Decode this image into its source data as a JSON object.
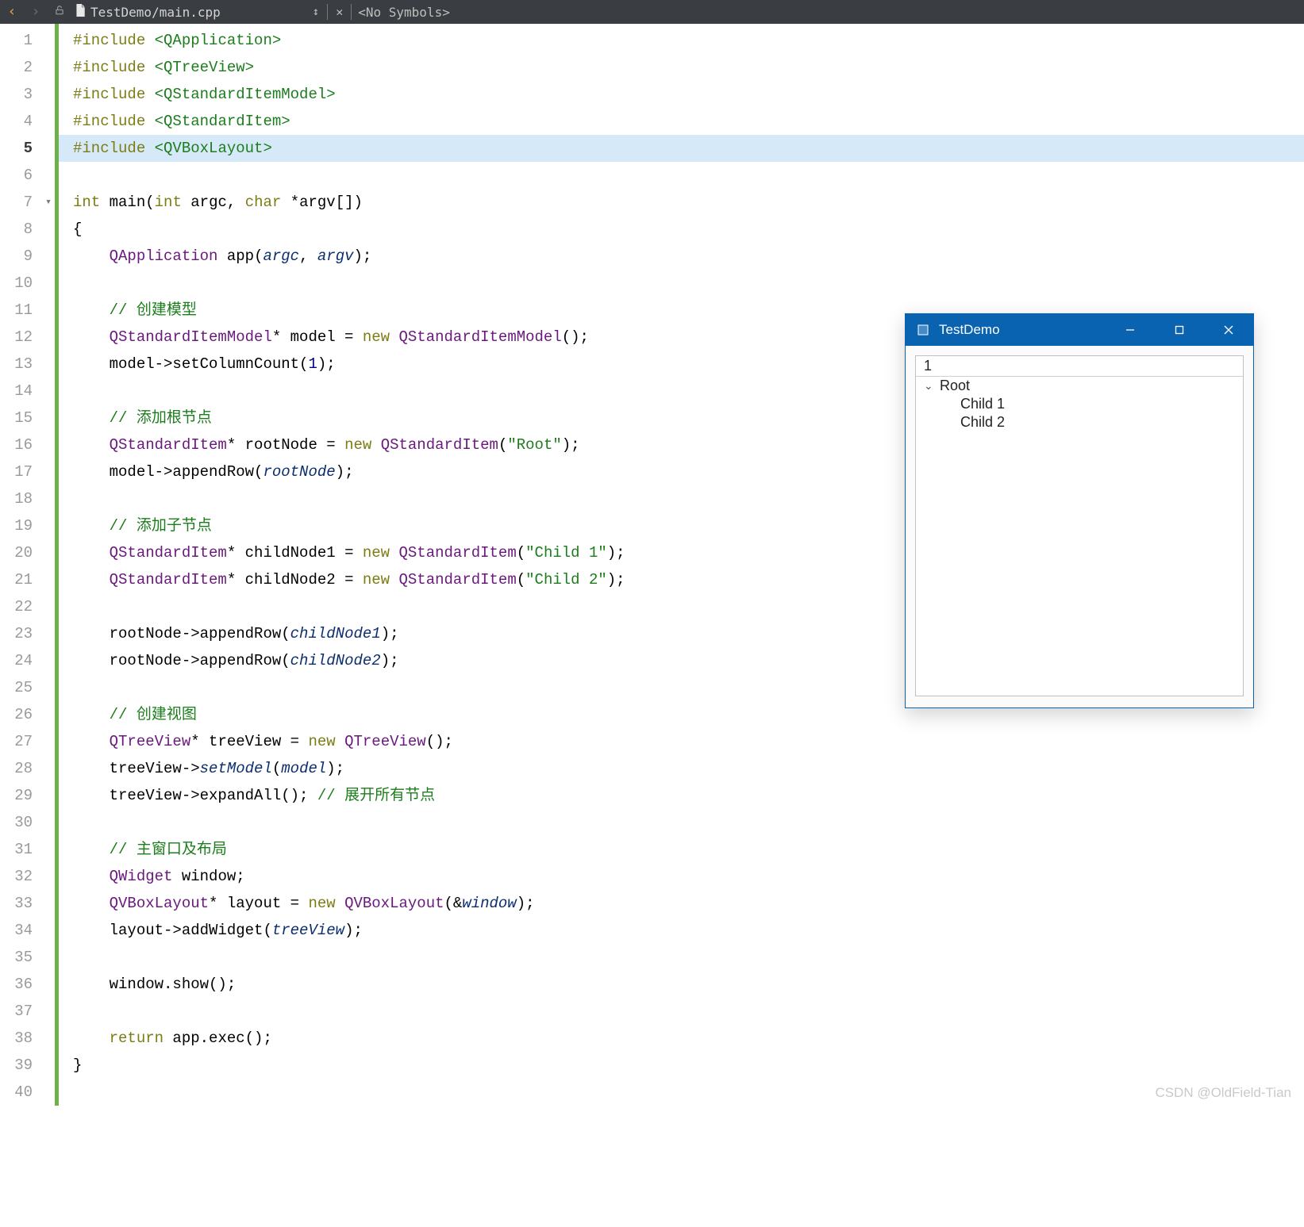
{
  "toolbar": {
    "filepath": "TestDemo/main.cpp",
    "symbols": "<No Symbols>"
  },
  "gutter": {
    "lines": [
      "1",
      "2",
      "3",
      "4",
      "5",
      "6",
      "7",
      "8",
      "9",
      "10",
      "11",
      "12",
      "13",
      "14",
      "15",
      "16",
      "17",
      "18",
      "19",
      "20",
      "21",
      "22",
      "23",
      "24",
      "25",
      "26",
      "27",
      "28",
      "29",
      "30",
      "31",
      "32",
      "33",
      "34",
      "35",
      "36",
      "37",
      "38",
      "39",
      "40"
    ],
    "current": 5,
    "foldAt": 7
  },
  "code": {
    "highlight": 5,
    "lines": [
      {
        "n": 1,
        "t": [
          [
            "kw",
            "#include"
          ],
          [
            "plain",
            " "
          ],
          [
            "ang",
            "<QApplication>"
          ]
        ]
      },
      {
        "n": 2,
        "t": [
          [
            "kw",
            "#include"
          ],
          [
            "plain",
            " "
          ],
          [
            "ang",
            "<QTreeView>"
          ]
        ]
      },
      {
        "n": 3,
        "t": [
          [
            "kw",
            "#include"
          ],
          [
            "plain",
            " "
          ],
          [
            "ang",
            "<QStandardItemModel>"
          ]
        ]
      },
      {
        "n": 4,
        "t": [
          [
            "kw",
            "#include"
          ],
          [
            "plain",
            " "
          ],
          [
            "ang",
            "<QStandardItem>"
          ]
        ]
      },
      {
        "n": 5,
        "t": [
          [
            "kw",
            "#include"
          ],
          [
            "plain",
            " "
          ],
          [
            "ang",
            "<QVBoxLayout>"
          ]
        ]
      },
      {
        "n": 6,
        "t": []
      },
      {
        "n": 7,
        "t": [
          [
            "kw",
            "int"
          ],
          [
            "plain",
            " "
          ],
          [
            "id",
            "main"
          ],
          [
            "plain",
            "("
          ],
          [
            "kw",
            "int"
          ],
          [
            "plain",
            " argc, "
          ],
          [
            "kw",
            "char"
          ],
          [
            "plain",
            " *argv[])"
          ]
        ]
      },
      {
        "n": 8,
        "t": [
          [
            "plain",
            "{"
          ]
        ]
      },
      {
        "n": 9,
        "t": [
          [
            "plain",
            "    "
          ],
          [
            "type",
            "QApplication"
          ],
          [
            "plain",
            " "
          ],
          [
            "id",
            "app"
          ],
          [
            "plain",
            "("
          ],
          [
            "param-it",
            "argc"
          ],
          [
            "plain",
            ", "
          ],
          [
            "param-it",
            "argv"
          ],
          [
            "plain",
            ");"
          ]
        ]
      },
      {
        "n": 10,
        "t": []
      },
      {
        "n": 11,
        "t": [
          [
            "plain",
            "    "
          ],
          [
            "cmt",
            "// 创建模型"
          ]
        ]
      },
      {
        "n": 12,
        "t": [
          [
            "plain",
            "    "
          ],
          [
            "type",
            "QStandardItemModel"
          ],
          [
            "plain",
            "* model = "
          ],
          [
            "kw",
            "new"
          ],
          [
            "plain",
            " "
          ],
          [
            "type",
            "QStandardItemModel"
          ],
          [
            "plain",
            "();"
          ]
        ]
      },
      {
        "n": 13,
        "t": [
          [
            "plain",
            "    model->setColumnCount("
          ],
          [
            "num",
            "1"
          ],
          [
            "plain",
            ");"
          ]
        ]
      },
      {
        "n": 14,
        "t": []
      },
      {
        "n": 15,
        "t": [
          [
            "plain",
            "    "
          ],
          [
            "cmt",
            "// 添加根节点"
          ]
        ]
      },
      {
        "n": 16,
        "t": [
          [
            "plain",
            "    "
          ],
          [
            "type",
            "QStandardItem"
          ],
          [
            "plain",
            "* rootNode = "
          ],
          [
            "kw",
            "new"
          ],
          [
            "plain",
            " "
          ],
          [
            "type",
            "QStandardItem"
          ],
          [
            "plain",
            "("
          ],
          [
            "str",
            "\"Root\""
          ],
          [
            "plain",
            ");"
          ]
        ]
      },
      {
        "n": 17,
        "t": [
          [
            "plain",
            "    model->appendRow("
          ],
          [
            "param-it",
            "rootNode"
          ],
          [
            "plain",
            ");"
          ]
        ]
      },
      {
        "n": 18,
        "t": []
      },
      {
        "n": 19,
        "t": [
          [
            "plain",
            "    "
          ],
          [
            "cmt",
            "// 添加子节点"
          ]
        ]
      },
      {
        "n": 20,
        "t": [
          [
            "plain",
            "    "
          ],
          [
            "type",
            "QStandardItem"
          ],
          [
            "plain",
            "* childNode1 = "
          ],
          [
            "kw",
            "new"
          ],
          [
            "plain",
            " "
          ],
          [
            "type",
            "QStandardItem"
          ],
          [
            "plain",
            "("
          ],
          [
            "str",
            "\"Child 1\""
          ],
          [
            "plain",
            ");"
          ]
        ]
      },
      {
        "n": 21,
        "t": [
          [
            "plain",
            "    "
          ],
          [
            "type",
            "QStandardItem"
          ],
          [
            "plain",
            "* childNode2 = "
          ],
          [
            "kw",
            "new"
          ],
          [
            "plain",
            " "
          ],
          [
            "type",
            "QStandardItem"
          ],
          [
            "plain",
            "("
          ],
          [
            "str",
            "\"Child 2\""
          ],
          [
            "plain",
            ");"
          ]
        ]
      },
      {
        "n": 22,
        "t": []
      },
      {
        "n": 23,
        "t": [
          [
            "plain",
            "    rootNode->appendRow("
          ],
          [
            "param-it",
            "childNode1"
          ],
          [
            "plain",
            ");"
          ]
        ]
      },
      {
        "n": 24,
        "t": [
          [
            "plain",
            "    rootNode->appendRow("
          ],
          [
            "param-it",
            "childNode2"
          ],
          [
            "plain",
            ");"
          ]
        ]
      },
      {
        "n": 25,
        "t": []
      },
      {
        "n": 26,
        "t": [
          [
            "plain",
            "    "
          ],
          [
            "cmt",
            "// 创建视图"
          ]
        ]
      },
      {
        "n": 27,
        "t": [
          [
            "plain",
            "    "
          ],
          [
            "type",
            "QTreeView"
          ],
          [
            "plain",
            "* treeView = "
          ],
          [
            "kw",
            "new"
          ],
          [
            "plain",
            " "
          ],
          [
            "type",
            "QTreeView"
          ],
          [
            "plain",
            "();"
          ]
        ]
      },
      {
        "n": 28,
        "t": [
          [
            "plain",
            "    treeView->"
          ],
          [
            "param-it",
            "setModel"
          ],
          [
            "plain",
            "("
          ],
          [
            "param-it",
            "model"
          ],
          [
            "plain",
            ");"
          ]
        ]
      },
      {
        "n": 29,
        "t": [
          [
            "plain",
            "    treeView->expandAll(); "
          ],
          [
            "cmt",
            "// 展开所有节点"
          ]
        ]
      },
      {
        "n": 30,
        "t": []
      },
      {
        "n": 31,
        "t": [
          [
            "plain",
            "    "
          ],
          [
            "cmt",
            "// 主窗口及布局"
          ]
        ]
      },
      {
        "n": 32,
        "t": [
          [
            "plain",
            "    "
          ],
          [
            "type",
            "QWidget"
          ],
          [
            "plain",
            " window;"
          ]
        ]
      },
      {
        "n": 33,
        "t": [
          [
            "plain",
            "    "
          ],
          [
            "type",
            "QVBoxLayout"
          ],
          [
            "plain",
            "* layout = "
          ],
          [
            "kw",
            "new"
          ],
          [
            "plain",
            " "
          ],
          [
            "type",
            "QVBoxLayout"
          ],
          [
            "plain",
            "(&"
          ],
          [
            "param-it",
            "window"
          ],
          [
            "plain",
            ");"
          ]
        ]
      },
      {
        "n": 34,
        "t": [
          [
            "plain",
            "    layout->addWidget("
          ],
          [
            "param-it",
            "treeView"
          ],
          [
            "plain",
            ");"
          ]
        ]
      },
      {
        "n": 35,
        "t": []
      },
      {
        "n": 36,
        "t": [
          [
            "plain",
            "    window.show();"
          ]
        ]
      },
      {
        "n": 37,
        "t": []
      },
      {
        "n": 38,
        "t": [
          [
            "plain",
            "    "
          ],
          [
            "kw",
            "return"
          ],
          [
            "plain",
            " app.exec();"
          ]
        ]
      },
      {
        "n": 39,
        "t": [
          [
            "plain",
            "}"
          ]
        ]
      },
      {
        "n": 40,
        "t": []
      }
    ]
  },
  "appwin": {
    "title": "TestDemo",
    "header": "1",
    "tree": {
      "root": "Root",
      "children": [
        "Child 1",
        "Child 2"
      ]
    }
  },
  "watermark": "CSDN @OldField-Tian"
}
